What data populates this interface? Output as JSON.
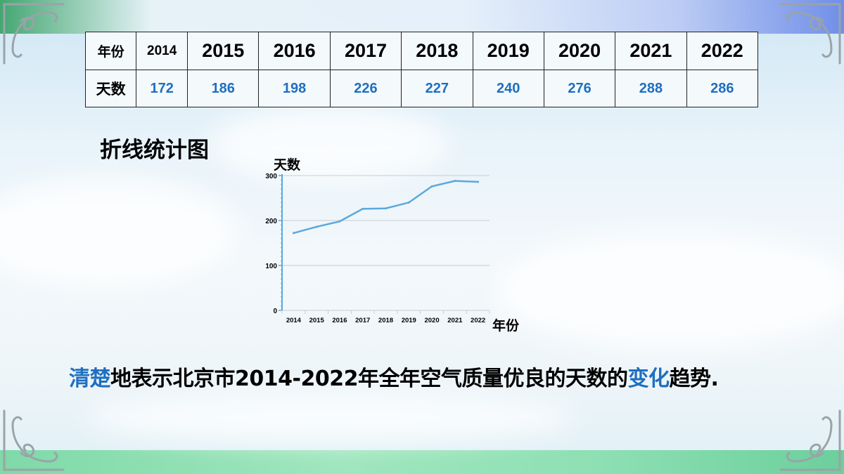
{
  "table": {
    "header_label": "年份",
    "row_label": "天数",
    "years": [
      "2014",
      "2015",
      "2016",
      "2017",
      "2018",
      "2019",
      "2020",
      "2021",
      "2022"
    ],
    "values": [
      "172",
      "186",
      "198",
      "226",
      "227",
      "240",
      "276",
      "288",
      "286"
    ]
  },
  "section_title": "折线统计图",
  "chart_data": {
    "type": "line",
    "x": [
      "2014",
      "2015",
      "2016",
      "2017",
      "2018",
      "2019",
      "2020",
      "2021",
      "2022"
    ],
    "values": [
      172,
      186,
      198,
      226,
      227,
      240,
      276,
      288,
      286
    ],
    "ylabel": "天数",
    "xlabel": "年份",
    "yticks": [
      "0",
      "100",
      "200",
      "300"
    ],
    "ylim": [
      0,
      300
    ],
    "grid": true,
    "line_color": "#5aa9dd"
  },
  "summary": {
    "hl1": "清楚",
    "mid": "地表示北京市2014-2022年全年空气质量优良的天数的",
    "hl2": "变化",
    "end": "趋势."
  }
}
